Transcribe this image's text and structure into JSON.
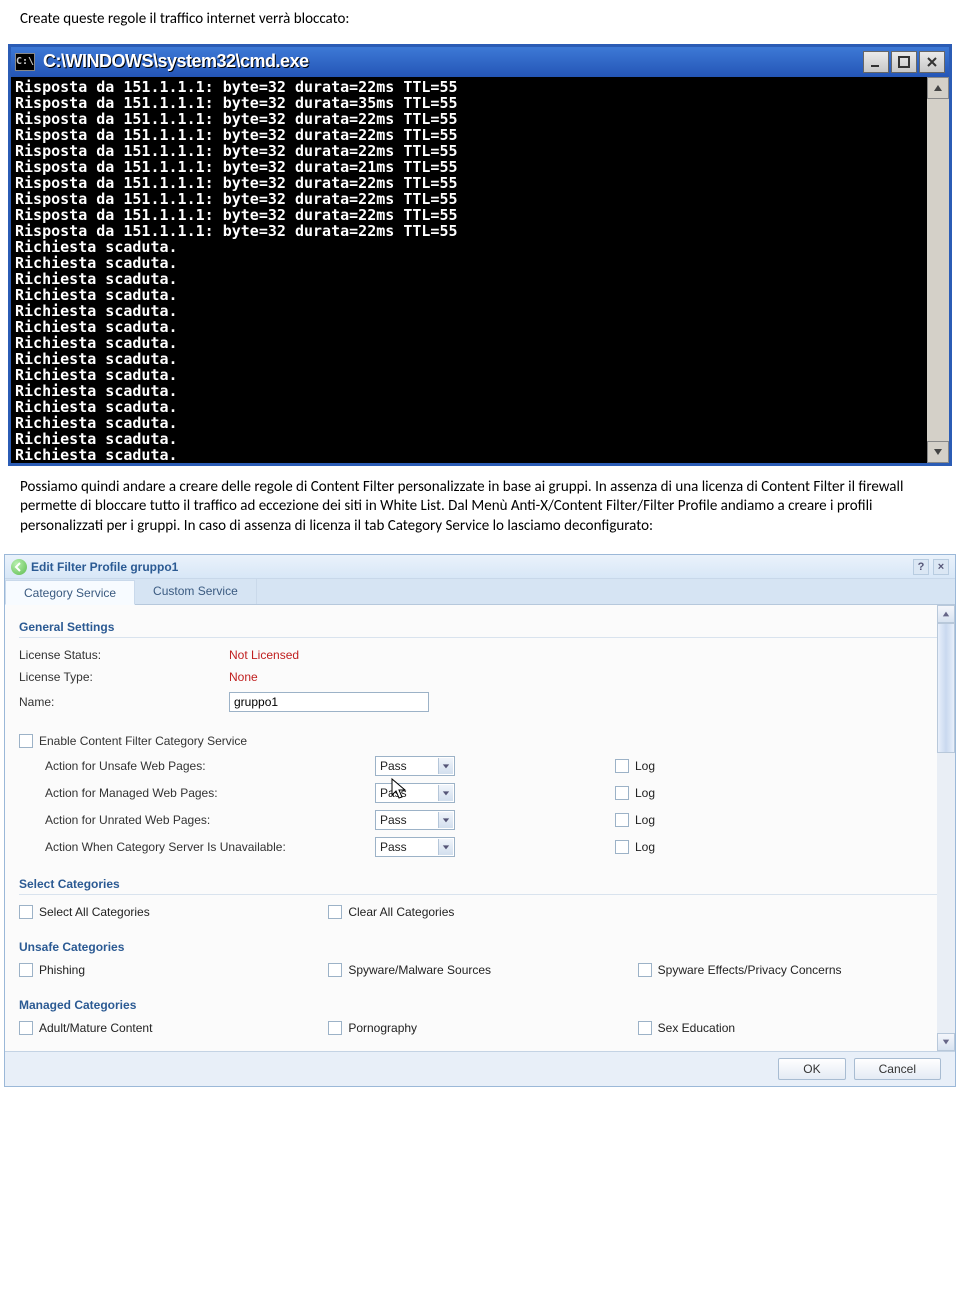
{
  "doc": {
    "intro": "Create queste regole il traffico internet verrà bloccato:",
    "after_cmd": "Possiamo quindi andare a creare delle regole di Content Filter personalizzate in base ai gruppi. In assenza di una licenza di Content Filter il firewall permette di bloccare tutto il traffico ad eccezione dei siti in White List. Dal Menù Anti-X/Content Filter/Filter Profile andiamo a creare i profili personalizzati per i gruppi. In caso di assenza di licenza il tab Category Service lo lasciamo deconfigurato:"
  },
  "cmd": {
    "icon_text": "C:\\",
    "title": "C:\\WINDOWS\\system32\\cmd.exe",
    "lines": [
      "Risposta da 151.1.1.1: byte=32 durata=22ms TTL=55",
      "Risposta da 151.1.1.1: byte=32 durata=35ms TTL=55",
      "Risposta da 151.1.1.1: byte=32 durata=22ms TTL=55",
      "Risposta da 151.1.1.1: byte=32 durata=22ms TTL=55",
      "Risposta da 151.1.1.1: byte=32 durata=22ms TTL=55",
      "Risposta da 151.1.1.1: byte=32 durata=21ms TTL=55",
      "Risposta da 151.1.1.1: byte=32 durata=22ms TTL=55",
      "Risposta da 151.1.1.1: byte=32 durata=22ms TTL=55",
      "Risposta da 151.1.1.1: byte=32 durata=22ms TTL=55",
      "Risposta da 151.1.1.1: byte=32 durata=22ms TTL=55",
      "Richiesta scaduta.",
      "Richiesta scaduta.",
      "Richiesta scaduta.",
      "Richiesta scaduta.",
      "Richiesta scaduta.",
      "Richiesta scaduta.",
      "Richiesta scaduta.",
      "Richiesta scaduta.",
      "Richiesta scaduta.",
      "Richiesta scaduta.",
      "Richiesta scaduta.",
      "Richiesta scaduta.",
      "Richiesta scaduta.",
      "Richiesta scaduta.",
      ""
    ]
  },
  "zy": {
    "title": "Edit Filter Profile gruppo1",
    "help_icon": "?",
    "close_icon": "×",
    "tabs": {
      "category": "Category Service",
      "custom": "Custom Service"
    },
    "general": {
      "heading": "General Settings",
      "license_status_lbl": "License Status:",
      "license_status_val": "Not Licensed",
      "license_type_lbl": "License Type:",
      "license_type_val": "None",
      "name_lbl": "Name:",
      "name_val": "gruppo1"
    },
    "enable_cat": "Enable Content Filter Category Service",
    "actions": {
      "unsafe_lbl": "Action for Unsafe Web Pages:",
      "managed_lbl": "Action for Managed Web Pages:",
      "unrated_lbl": "Action for Unrated Web Pages:",
      "server_lbl": "Action When Category Server Is Unavailable:",
      "pass": "Pass",
      "log": "Log"
    },
    "select_categories": {
      "heading": "Select Categories",
      "select_all": "Select All Categories",
      "clear_all": "Clear All Categories"
    },
    "unsafe_categories": {
      "heading": "Unsafe Categories",
      "phishing": "Phishing",
      "spyware_src": "Spyware/Malware Sources",
      "spyware_effects": "Spyware Effects/Privacy Concerns"
    },
    "managed_categories": {
      "heading": "Managed Categories",
      "adult": "Adult/Mature Content",
      "porn": "Pornography",
      "sex_ed": "Sex Education"
    },
    "footer": {
      "ok": "OK",
      "cancel": "Cancel"
    }
  }
}
